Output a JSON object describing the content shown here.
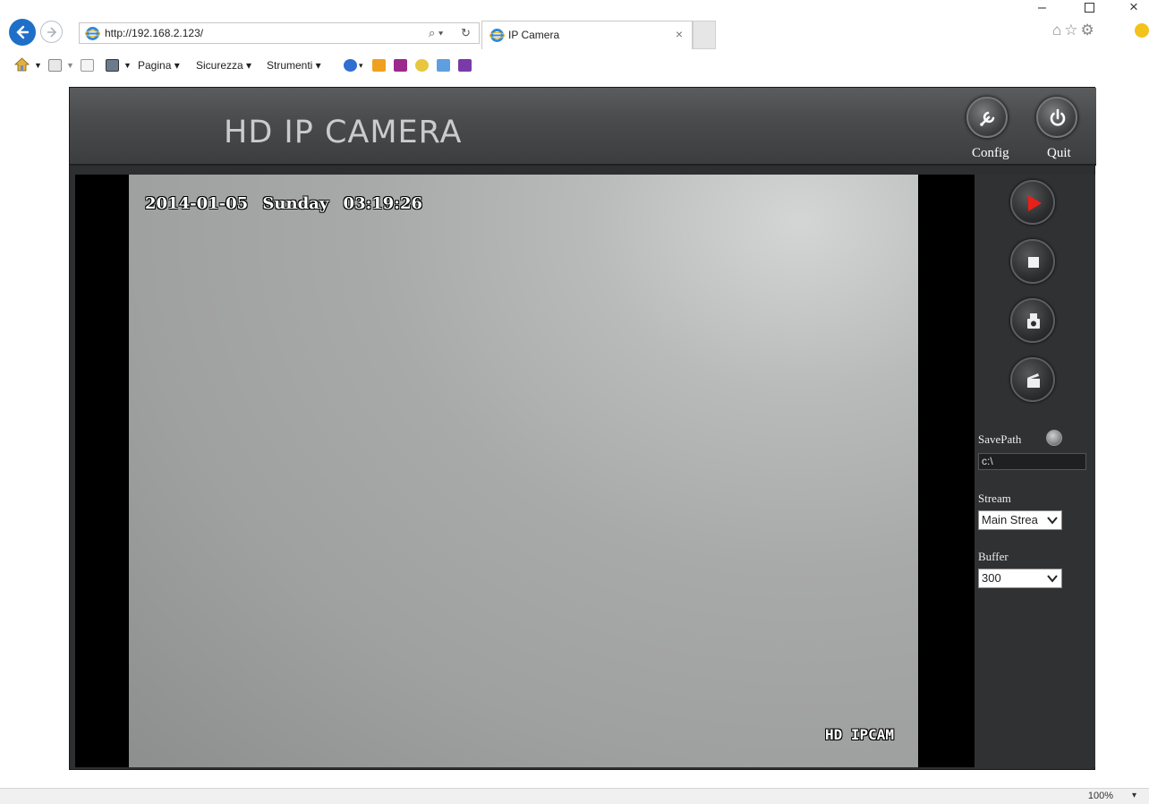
{
  "browser": {
    "url": "http://192.168.2.123/",
    "tab_title": "IP Camera",
    "tab_close": "×",
    "window_min": "–",
    "window_close": "×",
    "search_glyph": "⌕ ▾",
    "refresh_glyph": "↻",
    "toolbar_icons": "⌂☆⚙",
    "command_bar": {
      "page_label": "Pagina ▾",
      "security_label": "Sicurezza ▾",
      "tools_label": "Strumenti ▾",
      "help_label": "▾"
    },
    "zoom": "100%",
    "zoom_dropdown": "▾"
  },
  "app": {
    "title": "HD IP CAMERA",
    "config_label": "Config",
    "quit_label": "Quit",
    "osd_time": "2014-01-05 Sunday 03:19:26",
    "osd_brand": "HD IPCAM",
    "savepath_label": "SavePath",
    "savepath_value": "c:\\",
    "stream_label": "Stream",
    "stream_value": "Main Strea",
    "buffer_label": "Buffer",
    "buffer_value": "300"
  },
  "colors": {
    "accent_play": "#e8201a",
    "ie_blue": "#1e6fc8"
  }
}
